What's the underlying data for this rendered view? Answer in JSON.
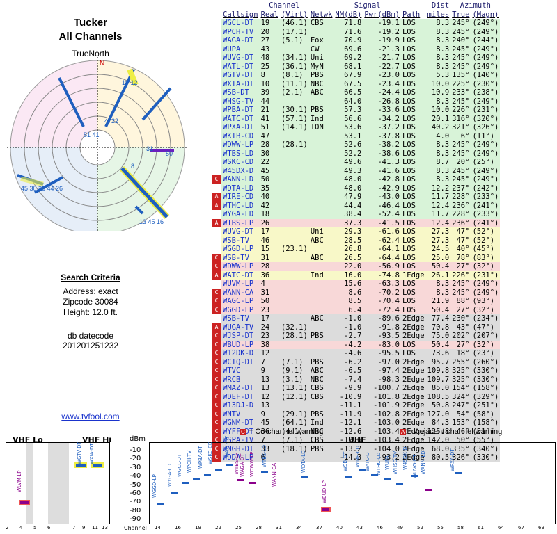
{
  "left": {
    "title1": "Tucker",
    "title2": "All Channels",
    "north": "TrueNorth",
    "search_title": "Search Criteria",
    "address": "Address: exact",
    "zipcode": "Zipcode 30084",
    "height": "Height: 12.0 ft.",
    "db_label": "db datecode",
    "db_value": "201201251232",
    "website": "www.tvfool.com"
  },
  "headers": {
    "channel": "Channel",
    "signal": "Signal",
    "dist": "Dist",
    "azimuth": "Azimuth",
    "callsign": "Callsign",
    "real": "Real",
    "virt": "(Virt)",
    "netwk": "Netwk",
    "nm": "NM(dB)",
    "pwr": "Pwr(dBm)",
    "path": "Path",
    "miles": "miles",
    "true": "True",
    "magn": "(Magn)"
  },
  "colors": {
    "green": "#d8f3d8",
    "yellow": "#f8f8c8",
    "red": "#f8d8d8",
    "gray": "#dcdcdc",
    "marker_red": "#cc2222"
  },
  "stations": [
    {
      "cs": "WGCL-DT",
      "real": "19",
      "virt": "(46.1)",
      "net": "CBS",
      "nm": "71.8",
      "pwr": "-19.1",
      "path": "LOS",
      "dist": "8.3",
      "tr": "245°",
      "mg": "(249°)",
      "band": "green",
      "mk": ""
    },
    {
      "cs": "WPCH-TV",
      "real": "20",
      "virt": "(17.1)",
      "net": "",
      "nm": "71.6",
      "pwr": "-19.2",
      "path": "LOS",
      "dist": "8.3",
      "tr": "245°",
      "mg": "(249°)",
      "band": "green",
      "mk": ""
    },
    {
      "cs": "WAGA-DT",
      "real": "27",
      "virt": "(5.1)",
      "net": "Fox",
      "nm": "70.9",
      "pwr": "-19.9",
      "path": "LOS",
      "dist": "8.3",
      "tr": "240°",
      "mg": "(244°)",
      "band": "green",
      "mk": ""
    },
    {
      "cs": "WUPA",
      "real": "43",
      "virt": "",
      "net": "CW",
      "nm": "69.6",
      "pwr": "-21.3",
      "path": "LOS",
      "dist": "8.3",
      "tr": "245°",
      "mg": "(249°)",
      "band": "green",
      "mk": ""
    },
    {
      "cs": "WUVG-DT",
      "real": "48",
      "virt": "(34.1)",
      "net": "Uni",
      "nm": "69.2",
      "pwr": "-21.7",
      "path": "LOS",
      "dist": "8.3",
      "tr": "245°",
      "mg": "(249°)",
      "band": "green",
      "mk": ""
    },
    {
      "cs": "WATL-DT",
      "real": "25",
      "virt": "(36.1)",
      "net": "MyN",
      "nm": "68.1",
      "pwr": "-22.7",
      "path": "LOS",
      "dist": "8.3",
      "tr": "245°",
      "mg": "(249°)",
      "band": "green",
      "mk": ""
    },
    {
      "cs": "WGTV-DT",
      "real": "8",
      "virt": "(8.1)",
      "net": "PBS",
      "nm": "67.9",
      "pwr": "-23.0",
      "path": "LOS",
      "dist": "5.3",
      "tr": "135°",
      "mg": "(140°)",
      "band": "green",
      "mk": ""
    },
    {
      "cs": "WXIA-DT",
      "real": "10",
      "virt": "(11.1)",
      "net": "NBC",
      "nm": "67.5",
      "pwr": "-23.4",
      "path": "LOS",
      "dist": "10.0",
      "tr": "225°",
      "mg": "(230°)",
      "band": "green",
      "mk": ""
    },
    {
      "cs": "WSB-DT",
      "real": "39",
      "virt": "(2.1)",
      "net": "ABC",
      "nm": "66.5",
      "pwr": "-24.4",
      "path": "LOS",
      "dist": "10.9",
      "tr": "233°",
      "mg": "(238°)",
      "band": "green",
      "mk": ""
    },
    {
      "cs": "WHSG-TV",
      "real": "44",
      "virt": "",
      "net": "",
      "nm": "64.0",
      "pwr": "-26.8",
      "path": "LOS",
      "dist": "8.3",
      "tr": "245°",
      "mg": "(249°)",
      "band": "green",
      "mk": ""
    },
    {
      "cs": "WPBA-DT",
      "real": "21",
      "virt": "(30.1)",
      "net": "PBS",
      "nm": "57.3",
      "pwr": "-33.6",
      "path": "LOS",
      "dist": "10.0",
      "tr": "226°",
      "mg": "(231°)",
      "band": "green",
      "mk": ""
    },
    {
      "cs": "WATC-DT",
      "real": "41",
      "virt": "(57.1)",
      "net": "Ind",
      "nm": "56.6",
      "pwr": "-34.2",
      "path": "LOS",
      "dist": "20.1",
      "tr": "316°",
      "mg": "(320°)",
      "band": "green",
      "mk": ""
    },
    {
      "cs": "WPXA-DT",
      "real": "51",
      "virt": "(14.1)",
      "net": "ION",
      "nm": "53.6",
      "pwr": "-37.2",
      "path": "LOS",
      "dist": "40.2",
      "tr": "321°",
      "mg": "(326°)",
      "band": "green",
      "mk": ""
    },
    {
      "cs": "WKTB-CD",
      "real": "47",
      "virt": "",
      "net": "",
      "nm": "53.1",
      "pwr": "-37.8",
      "path": "LOS",
      "dist": "4.0",
      "tr": "6°",
      "mg": "(11°)",
      "band": "green",
      "mk": ""
    },
    {
      "cs": "WDWW-LP",
      "real": "28",
      "virt": "(28.1)",
      "net": "",
      "nm": "52.6",
      "pwr": "-38.2",
      "path": "LOS",
      "dist": "8.3",
      "tr": "245°",
      "mg": "(249°)",
      "band": "green",
      "mk": ""
    },
    {
      "cs": "WTBS-LD",
      "real": "30",
      "virt": "",
      "net": "",
      "nm": "52.2",
      "pwr": "-38.6",
      "path": "LOS",
      "dist": "8.3",
      "tr": "245°",
      "mg": "(249°)",
      "band": "green",
      "mk": ""
    },
    {
      "cs": "WSKC-CD",
      "real": "22",
      "virt": "",
      "net": "",
      "nm": "49.6",
      "pwr": "-41.3",
      "path": "LOS",
      "dist": "8.7",
      "tr": "20°",
      "mg": "(25°)",
      "band": "green",
      "mk": ""
    },
    {
      "cs": "W45DX-D",
      "real": "45",
      "virt": "",
      "net": "",
      "nm": "49.3",
      "pwr": "-41.6",
      "path": "LOS",
      "dist": "8.3",
      "tr": "245°",
      "mg": "(249°)",
      "band": "green",
      "mk": ""
    },
    {
      "cs": "WANN-LD",
      "real": "50",
      "virt": "",
      "net": "",
      "nm": "48.0",
      "pwr": "-42.8",
      "path": "LOS",
      "dist": "8.3",
      "tr": "245°",
      "mg": "(249°)",
      "band": "green",
      "mk": "C"
    },
    {
      "cs": "WDTA-LD",
      "real": "35",
      "virt": "",
      "net": "",
      "nm": "48.0",
      "pwr": "-42.9",
      "path": "LOS",
      "dist": "12.2",
      "tr": "237°",
      "mg": "(242°)",
      "band": "green",
      "mk": ""
    },
    {
      "cs": "WIRE-CD",
      "real": "40",
      "virt": "",
      "net": "",
      "nm": "47.9",
      "pwr": "-43.0",
      "path": "LOS",
      "dist": "11.7",
      "tr": "228°",
      "mg": "(233°)",
      "band": "green",
      "mk": "A"
    },
    {
      "cs": "WTHC-LD",
      "real": "42",
      "virt": "",
      "net": "",
      "nm": "44.4",
      "pwr": "-46.4",
      "path": "LOS",
      "dist": "12.4",
      "tr": "236°",
      "mg": "(241°)",
      "band": "green",
      "mk": "A"
    },
    {
      "cs": "WYGA-LD",
      "real": "18",
      "virt": "",
      "net": "",
      "nm": "38.4",
      "pwr": "-52.4",
      "path": "LOS",
      "dist": "11.7",
      "tr": "228°",
      "mg": "(233°)",
      "band": "green",
      "mk": ""
    },
    {
      "cs": "WTBS-LP",
      "real": "26",
      "virt": "",
      "net": "",
      "nm": "37.3",
      "pwr": "-41.5",
      "path": "LOS",
      "dist": "12.4",
      "tr": "236°",
      "mg": "(241°)",
      "band": "red",
      "mk": "A"
    },
    {
      "cs": "WUVG-DT",
      "real": "17",
      "virt": "",
      "net": "Uni",
      "nm": "29.3",
      "pwr": "-61.6",
      "path": "LOS",
      "dist": "27.3",
      "tr": "47°",
      "mg": "(52°)",
      "band": "yellow",
      "mk": ""
    },
    {
      "cs": "WSB-TV",
      "real": "46",
      "virt": "",
      "net": "ABC",
      "nm": "28.5",
      "pwr": "-62.4",
      "path": "LOS",
      "dist": "27.3",
      "tr": "47°",
      "mg": "(52°)",
      "band": "yellow",
      "mk": ""
    },
    {
      "cs": "WGGD-LP",
      "real": "15",
      "virt": "(23.1)",
      "net": "",
      "nm": "26.8",
      "pwr": "-64.1",
      "path": "LOS",
      "dist": "24.5",
      "tr": "40°",
      "mg": "(45°)",
      "band": "yellow",
      "mk": ""
    },
    {
      "cs": "WSB-TV",
      "real": "31",
      "virt": "",
      "net": "ABC",
      "nm": "26.5",
      "pwr": "-64.4",
      "path": "LOS",
      "dist": "25.0",
      "tr": "78°",
      "mg": "(83°)",
      "band": "yellow",
      "mk": "C"
    },
    {
      "cs": "WDWW-LP",
      "real": "28",
      "virt": "",
      "net": "",
      "nm": "22.0",
      "pwr": "-56.9",
      "path": "LOS",
      "dist": "50.4",
      "tr": "27°",
      "mg": "(32°)",
      "band": "red",
      "mk": "C"
    },
    {
      "cs": "WATC-DT",
      "real": "36",
      "virt": "",
      "net": "Ind",
      "nm": "16.0",
      "pwr": "-74.8",
      "path": "1Edge",
      "dist": "26.1",
      "tr": "226°",
      "mg": "(231°)",
      "band": "yellow",
      "mk": "A"
    },
    {
      "cs": "WUVM-LP",
      "real": "4",
      "virt": "",
      "net": "",
      "nm": "15.6",
      "pwr": "-63.3",
      "path": "LOS",
      "dist": "8.3",
      "tr": "245°",
      "mg": "(249°)",
      "band": "red",
      "mk": ""
    },
    {
      "cs": "WANN-CA",
      "real": "31",
      "virt": "",
      "net": "",
      "nm": "8.6",
      "pwr": "-70.2",
      "path": "LOS",
      "dist": "8.3",
      "tr": "245°",
      "mg": "(249°)",
      "band": "red",
      "mk": "C"
    },
    {
      "cs": "WAGC-LP",
      "real": "50",
      "virt": "",
      "net": "",
      "nm": "8.5",
      "pwr": "-70.4",
      "path": "LOS",
      "dist": "21.9",
      "tr": "88°",
      "mg": "(93°)",
      "band": "red",
      "mk": "C"
    },
    {
      "cs": "WGGD-LP",
      "real": "23",
      "virt": "",
      "net": "",
      "nm": "6.4",
      "pwr": "-72.4",
      "path": "LOS",
      "dist": "50.4",
      "tr": "27°",
      "mg": "(32°)",
      "band": "red",
      "mk": "C"
    },
    {
      "cs": "WSB-TV",
      "real": "17",
      "virt": "",
      "net": "ABC",
      "nm": "-1.0",
      "pwr": "-89.6",
      "path": "2Edge",
      "dist": "77.4",
      "tr": "230°",
      "mg": "(234°)",
      "band": "gray",
      "mk": ""
    },
    {
      "cs": "WUGA-TV",
      "real": "24",
      "virt": "(32.1)",
      "net": "",
      "nm": "-1.0",
      "pwr": "-91.8",
      "path": "2Edge",
      "dist": "70.8",
      "tr": "43°",
      "mg": "(47°)",
      "band": "gray",
      "mk": "A"
    },
    {
      "cs": "WJSP-DT",
      "real": "23",
      "virt": "(28.1)",
      "net": "PBS",
      "nm": "-2.7",
      "pwr": "-93.5",
      "path": "2Edge",
      "dist": "75.0",
      "tr": "202°",
      "mg": "(207°)",
      "band": "gray",
      "mk": "C"
    },
    {
      "cs": "WBUD-LP",
      "real": "38",
      "virt": "",
      "net": "",
      "nm": "-4.2",
      "pwr": "-83.0",
      "path": "LOS",
      "dist": "50.4",
      "tr": "27°",
      "mg": "(32°)",
      "band": "red",
      "mk": "C"
    },
    {
      "cs": "W12DK-D",
      "real": "12",
      "virt": "",
      "net": "",
      "nm": "-4.6",
      "pwr": "-95.5",
      "path": "LOS",
      "dist": "73.6",
      "tr": "18°",
      "mg": "(23°)",
      "band": "gray",
      "mk": "C"
    },
    {
      "cs": "WCIQ-DT",
      "real": "7",
      "virt": "(7.1)",
      "net": "PBS",
      "nm": "-6.2",
      "pwr": "-97.0",
      "path": "2Edge",
      "dist": "95.7",
      "tr": "255°",
      "mg": "(260°)",
      "band": "gray",
      "mk": "C"
    },
    {
      "cs": "WTVC",
      "real": "9",
      "virt": "(9.1)",
      "net": "ABC",
      "nm": "-6.5",
      "pwr": "-97.4",
      "path": "2Edge",
      "dist": "109.8",
      "tr": "325°",
      "mg": "(330°)",
      "band": "gray",
      "mk": "C"
    },
    {
      "cs": "WRCB",
      "real": "13",
      "virt": "(3.1)",
      "net": "NBC",
      "nm": "-7.4",
      "pwr": "-98.3",
      "path": "2Edge",
      "dist": "109.7",
      "tr": "325°",
      "mg": "(330°)",
      "band": "gray",
      "mk": "C"
    },
    {
      "cs": "WMAZ-DT",
      "real": "13",
      "virt": "(13.1)",
      "net": "CBS",
      "nm": "-9.9",
      "pwr": "-100.7",
      "path": "2Edge",
      "dist": "85.0",
      "tr": "154°",
      "mg": "(158°)",
      "band": "gray",
      "mk": "C"
    },
    {
      "cs": "WDEF-DT",
      "real": "12",
      "virt": "(12.1)",
      "net": "CBS",
      "nm": "-10.9",
      "pwr": "-101.8",
      "path": "2Edge",
      "dist": "108.5",
      "tr": "324°",
      "mg": "(329°)",
      "band": "gray",
      "mk": "C"
    },
    {
      "cs": "W13DJ-D",
      "real": "13",
      "virt": "",
      "net": "",
      "nm": "-11.1",
      "pwr": "-101.9",
      "path": "2Edge",
      "dist": "50.8",
      "tr": "247°",
      "mg": "(251°)",
      "band": "gray",
      "mk": "C"
    },
    {
      "cs": "WNTV",
      "real": "9",
      "virt": "(29.1)",
      "net": "PBS",
      "nm": "-11.9",
      "pwr": "-102.8",
      "path": "2Edge",
      "dist": "127.0",
      "tr": "54°",
      "mg": "(58°)",
      "band": "gray",
      "mk": "C"
    },
    {
      "cs": "WGNM-DT",
      "real": "45",
      "virt": "(64.1)",
      "net": "Ind",
      "nm": "-12.1",
      "pwr": "-103.0",
      "path": "2Edge",
      "dist": "84.3",
      "tr": "153°",
      "mg": "(158°)",
      "band": "gray",
      "mk": "C"
    },
    {
      "cs": "WYFF-DT",
      "real": "36",
      "virt": "(4.1)",
      "net": "NBC",
      "nm": "-12.6",
      "pwr": "-103.4",
      "path": "2Edge",
      "dist": "125.8",
      "tr": "46°",
      "mg": "(51°)",
      "band": "gray",
      "mk": "C"
    },
    {
      "cs": "WSPA-TV",
      "real": "7",
      "virt": "(7.1)",
      "net": "CBS",
      "nm": "-12.6",
      "pwr": "-103.4",
      "path": "2Edge",
      "dist": "142.0",
      "tr": "50°",
      "mg": "(55°)",
      "band": "gray",
      "mk": "C"
    },
    {
      "cs": "WNGH-DT",
      "real": "33",
      "virt": "(18.1)",
      "net": "PBS",
      "nm": "-13.2",
      "pwr": "-104.0",
      "path": "2Edge",
      "dist": "68.0",
      "tr": "335°",
      "mg": "(340°)",
      "band": "gray",
      "mk": "C"
    },
    {
      "cs": "WDDA-LP",
      "real": "6",
      "virt": "",
      "net": "",
      "nm": "-14.3",
      "pwr": "-93.2",
      "path": "2Edge",
      "dist": "80.5",
      "tr": "326°",
      "mg": "(330°)",
      "band": "gray",
      "mk": "C"
    }
  ],
  "legend": {
    "co_channel": "= Co-channel warning",
    "adjacent": "= Adjacent channel warning",
    "c_marker": "C",
    "a_marker": "A"
  },
  "spectrum": {
    "vhf_lo": "VHF Lo",
    "vhf_hi": "VHF Hi",
    "uhf": "UHF",
    "dbm": "dBm",
    "channel": "Channel",
    "y_ticks": [
      "-10",
      "-20",
      "-30",
      "-40",
      "-50",
      "-60",
      "-70",
      "-80",
      "-90"
    ],
    "x_ticks_lo": [
      "2",
      "4",
      "5",
      "6"
    ],
    "x_ticks_hi": [
      "7",
      "9",
      "11",
      "13"
    ],
    "x_ticks_uhf": [
      "14",
      "16",
      "19",
      "22",
      "25",
      "28",
      "31",
      "34",
      "37",
      "40",
      "43",
      "46",
      "49",
      "52",
      "55",
      "58",
      "61",
      "64",
      "67",
      "69"
    ]
  }
}
